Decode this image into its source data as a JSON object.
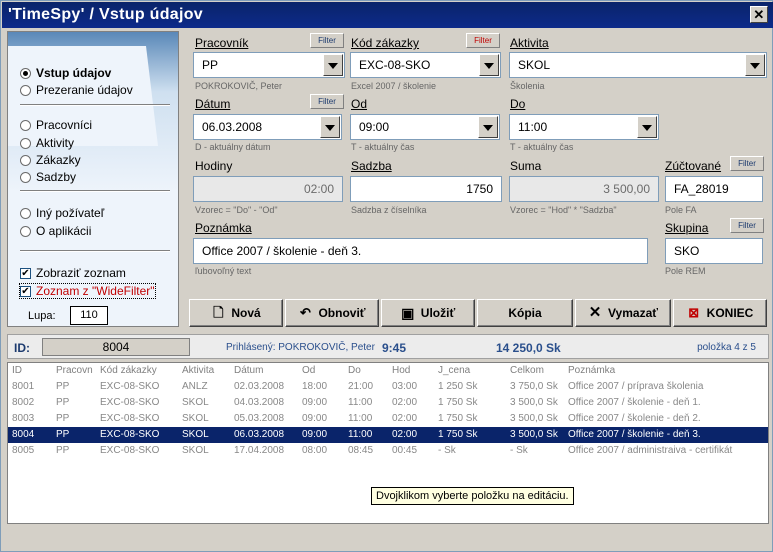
{
  "window": {
    "title": "'TimeSpy' / Vstup údajov",
    "close_glyph": "✕"
  },
  "sidebar": {
    "modes": [
      {
        "label": "Vstup údajov",
        "selected": true
      },
      {
        "label": "Prezeranie údajov",
        "selected": false
      }
    ],
    "lists": [
      "Pracovníci",
      "Aktivity",
      "Zákazky",
      "Sadzby"
    ],
    "other": [
      "Iný požívateľ",
      "O aplikácii"
    ],
    "check_list": "Zobraziť zoznam",
    "check_widefilter": "Zoznam z \"WideFilter\"",
    "zoom_label": "Lupa:",
    "zoom_value": "110"
  },
  "form": {
    "filter_label": "Filter",
    "pracovnik": {
      "label": "Pracovník",
      "value": "PP",
      "hint": "POKROKOVIČ, Peter"
    },
    "kod": {
      "label": "Kód zákazky",
      "value": "EXC-08-SKO",
      "hint": "Excel 2007 / školenie"
    },
    "aktivita": {
      "label": "Aktivita",
      "value": "SKOL",
      "hint": "Školenia"
    },
    "datum": {
      "label": "Dátum",
      "value": "06.03.2008",
      "hint": "D - aktuálny dátum"
    },
    "od": {
      "label": "Od",
      "value": "09:00",
      "hint": "T - aktuálny čas"
    },
    "do": {
      "label": "Do",
      "value": "11:00",
      "hint": "T - aktuálny čas"
    },
    "hodiny": {
      "label": "Hodiny",
      "value": "02:00",
      "hint": "Vzorec = \"Do\" - \"Od\""
    },
    "sadzba": {
      "label": "Sadzba",
      "value": "1750",
      "hint": "Sadzba z číselníka"
    },
    "suma": {
      "label": "Suma",
      "value": "3 500,00",
      "hint": "Vzorec = \"Hod\" * \"Sadzba\""
    },
    "zuctovane": {
      "label": "Zúčtované",
      "value": "FA_28019",
      "hint": "Pole FA"
    },
    "poznamka": {
      "label": "Poznámka",
      "value": "Office 2007 / školenie - deň 3.",
      "hint": "ľubovoľný text"
    },
    "skupina": {
      "label": "Skupina",
      "value": "SKO",
      "hint": "Pole REM"
    }
  },
  "buttons": {
    "nova": "Nová",
    "obnovit": "Obnoviť",
    "ulozit": "Uložiť",
    "kopia": "Kópia",
    "vymazat": "Vymazať",
    "koniec": "KONIEC"
  },
  "status": {
    "id_label": "ID:",
    "id_value": "8004",
    "logged": "Prihlásený: POKROKOVIČ, Peter",
    "time": "9:45",
    "total": "14 250,0 Sk",
    "position": "položka 4 z 5"
  },
  "table": {
    "headers": [
      "ID",
      "Pracovn",
      "Kód zákazky",
      "Aktivita",
      "Dátum",
      "Od",
      "Do",
      "Hod",
      "J_cena",
      "Celkom",
      "Poznámka"
    ],
    "rows": [
      [
        "8001",
        "PP",
        "EXC-08-SKO",
        "ANLZ",
        "02.03.2008",
        "18:00",
        "21:00",
        "03:00",
        "1 250 Sk",
        "3 750,0 Sk",
        "Office 2007 / príprava školenia"
      ],
      [
        "8002",
        "PP",
        "EXC-08-SKO",
        "SKOL",
        "04.03.2008",
        "09:00",
        "11:00",
        "02:00",
        "1 750 Sk",
        "3 500,0 Sk",
        "Office 2007 / školenie - deň 1."
      ],
      [
        "8003",
        "PP",
        "EXC-08-SKO",
        "SKOL",
        "05.03.2008",
        "09:00",
        "11:00",
        "02:00",
        "1 750 Sk",
        "3 500,0 Sk",
        "Office 2007 / školenie - deň 2."
      ],
      [
        "8004",
        "PP",
        "EXC-08-SKO",
        "SKOL",
        "06.03.2008",
        "09:00",
        "11:00",
        "02:00",
        "1 750 Sk",
        "3 500,0 Sk",
        "Office 2007 / školenie - deň 3."
      ],
      [
        "8005",
        "PP",
        "EXC-08-SKO",
        "SKOL",
        "17.04.2008",
        "08:00",
        "08:45",
        "00:45",
        "- Sk",
        "- Sk",
        "Office 2007 / administraiva - certifikát"
      ]
    ],
    "selected_index": 3
  },
  "tooltip": "Dvojklikom vyberte položku na editáciu."
}
